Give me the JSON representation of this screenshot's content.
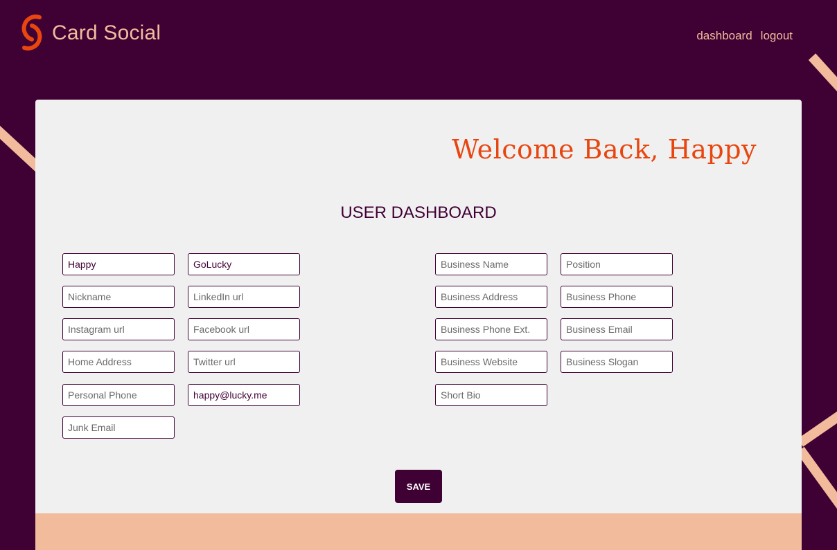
{
  "header": {
    "brand": "Card Social",
    "logo_icon": "card-social-logo",
    "nav": {
      "dashboard": "dashboard",
      "logout": "logout"
    }
  },
  "main": {
    "welcome": "Welcome Back, Happy",
    "title": "USER DASHBOARD",
    "personal": {
      "first_name": {
        "value": "Happy",
        "placeholder": ""
      },
      "last_name": {
        "value": "GoLucky",
        "placeholder": ""
      },
      "nickname": {
        "value": "",
        "placeholder": "Nickname"
      },
      "linkedin": {
        "value": "",
        "placeholder": "LinkedIn url"
      },
      "instagram": {
        "value": "",
        "placeholder": "Instagram url"
      },
      "facebook": {
        "value": "",
        "placeholder": "Facebook url"
      },
      "home_address": {
        "value": "",
        "placeholder": "Home Address"
      },
      "twitter": {
        "value": "",
        "placeholder": "Twitter url"
      },
      "personal_phone": {
        "value": "",
        "placeholder": "Personal Phone"
      },
      "email": {
        "value": "happy@lucky.me",
        "placeholder": ""
      },
      "junk_email": {
        "value": "",
        "placeholder": "Junk Email"
      }
    },
    "business": {
      "business_name": {
        "value": "",
        "placeholder": "Business Name"
      },
      "position": {
        "value": "",
        "placeholder": "Position"
      },
      "business_address": {
        "value": "",
        "placeholder": "Business Address"
      },
      "business_phone": {
        "value": "",
        "placeholder": "Business Phone"
      },
      "business_phone_ext": {
        "value": "",
        "placeholder": "Business Phone Ext."
      },
      "business_email": {
        "value": "",
        "placeholder": "Business Email"
      },
      "business_website": {
        "value": "",
        "placeholder": "Business Website"
      },
      "business_slogan": {
        "value": "",
        "placeholder": "Business Slogan"
      },
      "short_bio": {
        "value": "",
        "placeholder": "Short Bio"
      }
    },
    "save_label": "SAVE"
  },
  "colors": {
    "background": "#3f0033",
    "accent_peach": "#f2bc9c",
    "accent_orange": "#e8460f",
    "card": "#f1f0f1"
  }
}
